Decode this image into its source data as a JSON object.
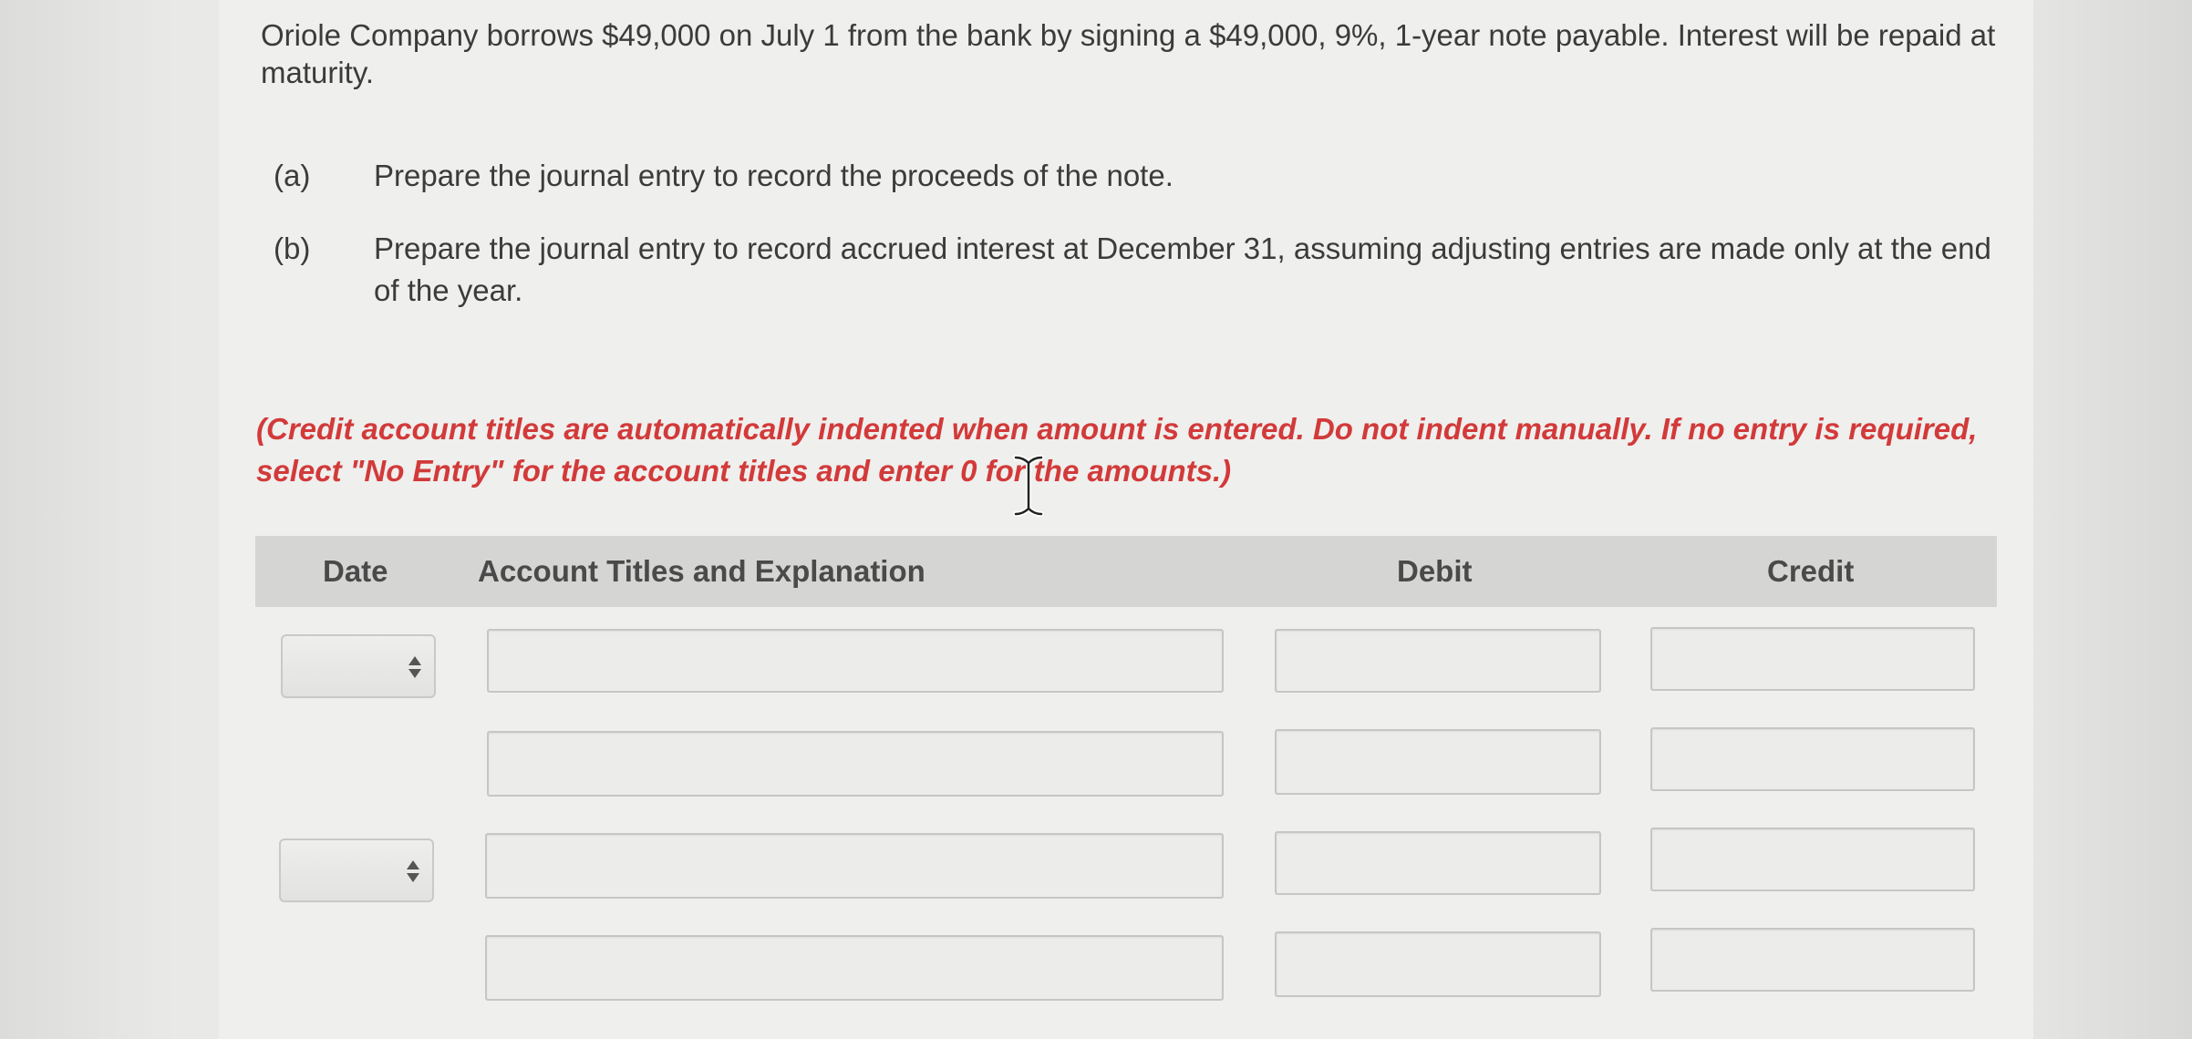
{
  "problem": {
    "intro": "Oriole Company borrows $49,000 on July 1 from the bank by signing a $49,000, 9%, 1-year note payable. Interest will be repaid at maturity.",
    "requirements": [
      {
        "letter": "(a)",
        "text": "Prepare the journal entry to record the proceeds of the note."
      },
      {
        "letter": "(b)",
        "text": "Prepare the journal entry to record accrued interest at December 31, assuming adjusting entries are made only at the end of the year."
      }
    ],
    "instruction": "(Credit account titles are automatically indented when amount is entered. Do not indent manually. If no entry is required, select \"No Entry\" for the account titles and enter 0 for the amounts.)"
  },
  "journal_table": {
    "headers": {
      "date": "Date",
      "account": "Account Titles and Explanation",
      "debit": "Debit",
      "credit": "Credit"
    },
    "rows": [
      {
        "date": "",
        "account": "",
        "debit": "",
        "credit": ""
      },
      {
        "account": "",
        "debit": "",
        "credit": ""
      },
      {
        "date": "",
        "account": "",
        "debit": "",
        "credit": ""
      },
      {
        "account": "",
        "debit": "",
        "credit": ""
      }
    ]
  },
  "colors": {
    "instruction_red": "#d23a3a",
    "header_bar": "#d5d5d3",
    "field_border": "#c6c6c4"
  },
  "icons": {
    "date_select": "up-down-arrows-icon",
    "cursor": "text-cursor-icon"
  }
}
